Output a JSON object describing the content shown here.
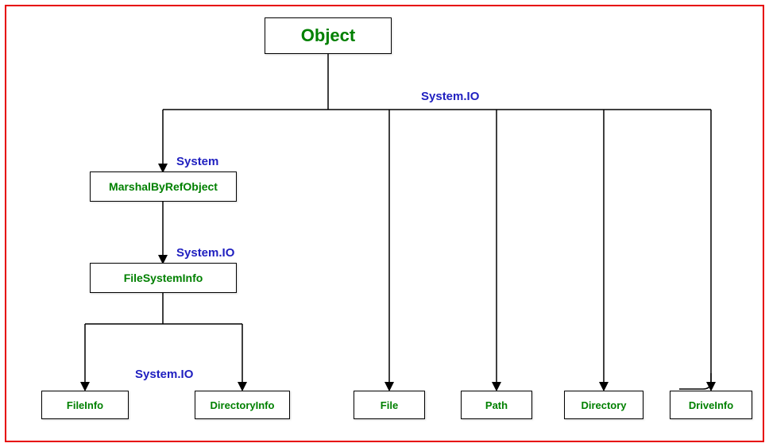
{
  "nodes": {
    "object": "Object",
    "marshal": "MarshalByRefObject",
    "fsi": "FileSystemInfo",
    "fileinfo": "FileInfo",
    "directoryinfo": "DirectoryInfo",
    "file": "File",
    "path": "Path",
    "directory": "Directory",
    "driveinfo": "DriveInfo"
  },
  "labels": {
    "top_namespace": "System.IO",
    "system": "System",
    "mid_namespace": "System.IO",
    "bottom_namespace": "System.IO"
  }
}
